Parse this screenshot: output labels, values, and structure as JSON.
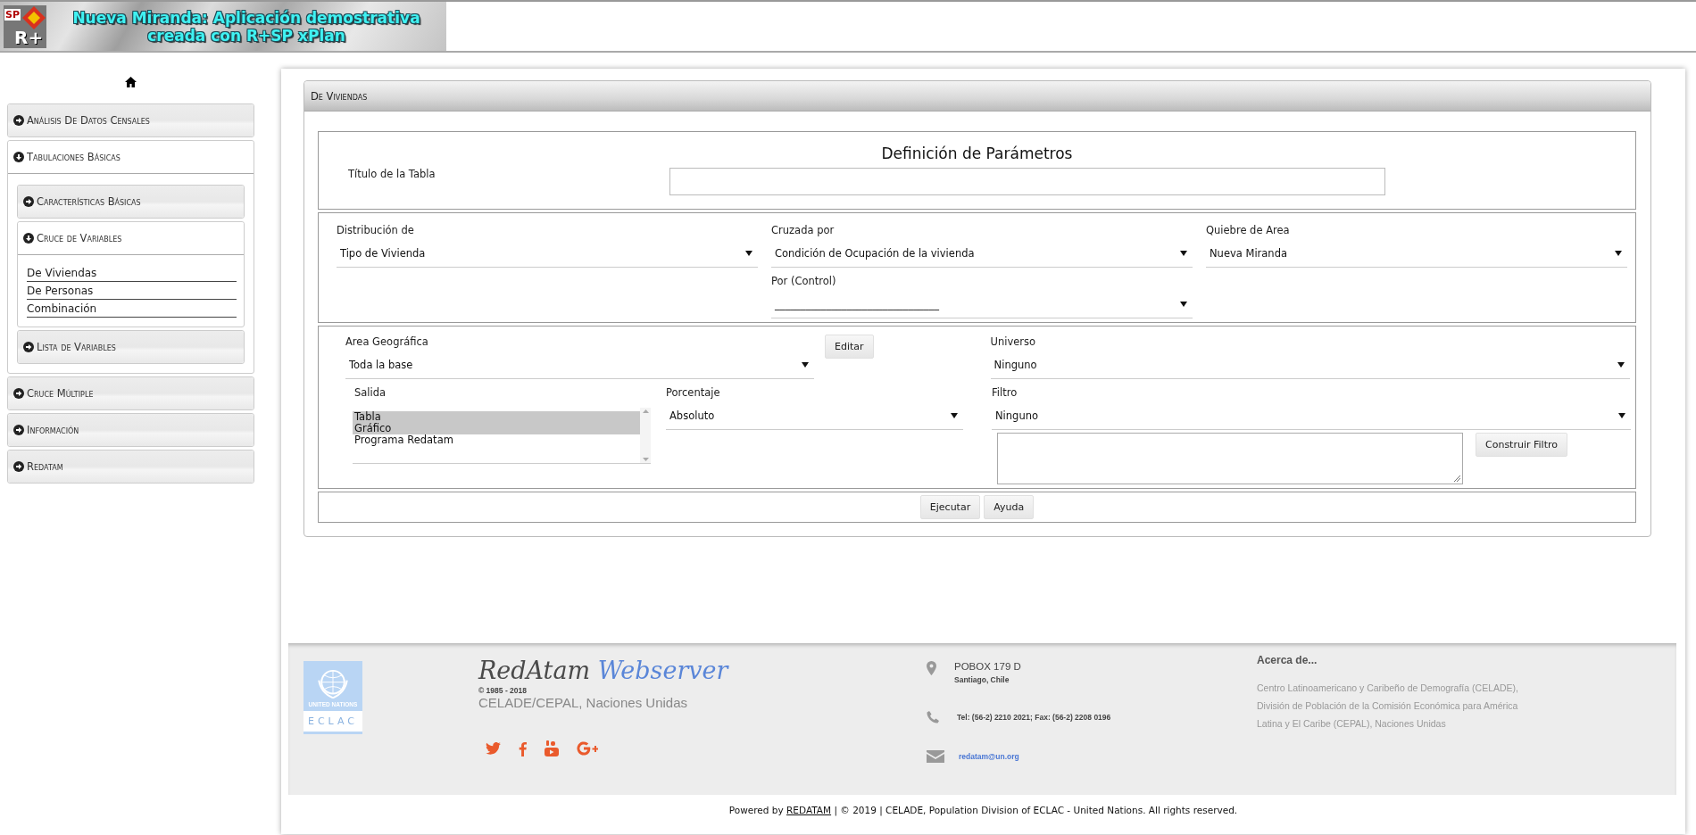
{
  "header": {
    "title": [
      "Nueva Miranda: Aplicación demostrativa",
      "creada con R+SP xPlan"
    ],
    "logo_text": [
      "SP",
      "R+"
    ]
  },
  "sidebar": {
    "items": [
      {
        "label": "Análisis De Datos Censales",
        "expanded": false
      },
      {
        "label": "Tabulaciones Básicas",
        "expanded": true,
        "children": [
          {
            "label": "Características Básicas",
            "expanded": false
          },
          {
            "label": "Cruce de Variables",
            "expanded": true,
            "links": [
              "De Viviendas",
              "De Personas",
              "Combinación"
            ]
          },
          {
            "label": "Lista de Variables",
            "expanded": false
          }
        ]
      },
      {
        "label": "Cruce Múltiple",
        "expanded": false
      },
      {
        "label": "Información",
        "expanded": false
      },
      {
        "label": "Redatam",
        "expanded": false
      }
    ]
  },
  "panel": {
    "title": "De Viviendas",
    "heading": "Definición de Parámetros",
    "table_title": {
      "label": "Título de la Tabla"
    },
    "distribution": {
      "label": "Distribución de",
      "value": "Tipo de Vivienda"
    },
    "crossed_by": {
      "label": "Cruzada por",
      "value": "Condición de Ocupación de la vivienda"
    },
    "area_break": {
      "label": "Quiebre de Area",
      "value": "Nueva Miranda"
    },
    "control": {
      "label": "Por (Control)",
      "value": "________________________________"
    },
    "geographic_area": {
      "label": "Area Geográfica",
      "value": "Toda la base"
    },
    "edit_button": "Editar",
    "universe": {
      "label": "Universo",
      "value": "Ninguno"
    },
    "output": {
      "label": "Salida",
      "options": [
        {
          "label": "Tabla",
          "selected": true
        },
        {
          "label": "Gráfico",
          "selected": true
        },
        {
          "label": "Programa Redatam",
          "selected": false
        }
      ]
    },
    "percentage": {
      "label": "Porcentaje",
      "value": "Absoluto"
    },
    "filter": {
      "label": "Filtro",
      "value": "Ninguno"
    },
    "build_filter_button": "Construir Filtro",
    "buttons": [
      "Ejecutar",
      "Ayuda"
    ]
  },
  "footer": {
    "logo_text": [
      "UNITED NATIONS",
      "ECLAC"
    ],
    "brand": [
      "RedAtam",
      "Webserver"
    ],
    "years": "© 1985 - 2018",
    "org": "CELADE/CEPAL, Naciones Unidas",
    "address": [
      "POBOX 179 D",
      "Santiago, Chile"
    ],
    "phone": "Tel: (56-2) 2210 2021; Fax: (56-2) 2208 0196",
    "email": "redatam@un.org",
    "about_title": "Acerca de...",
    "about_text": "Centro Latinoamericano y Caribeño de Demografía (CELADE), División de Población de la Comisión Económica para América Latina y El Caribe (CEPAL), Naciones Unidas",
    "powered": {
      "prefix": "Powered by",
      "link": "REDATAM",
      "suffix": "| © 2019 | CELADE, Population Division of ECLAC - United Nations. All rights reserved."
    }
  }
}
